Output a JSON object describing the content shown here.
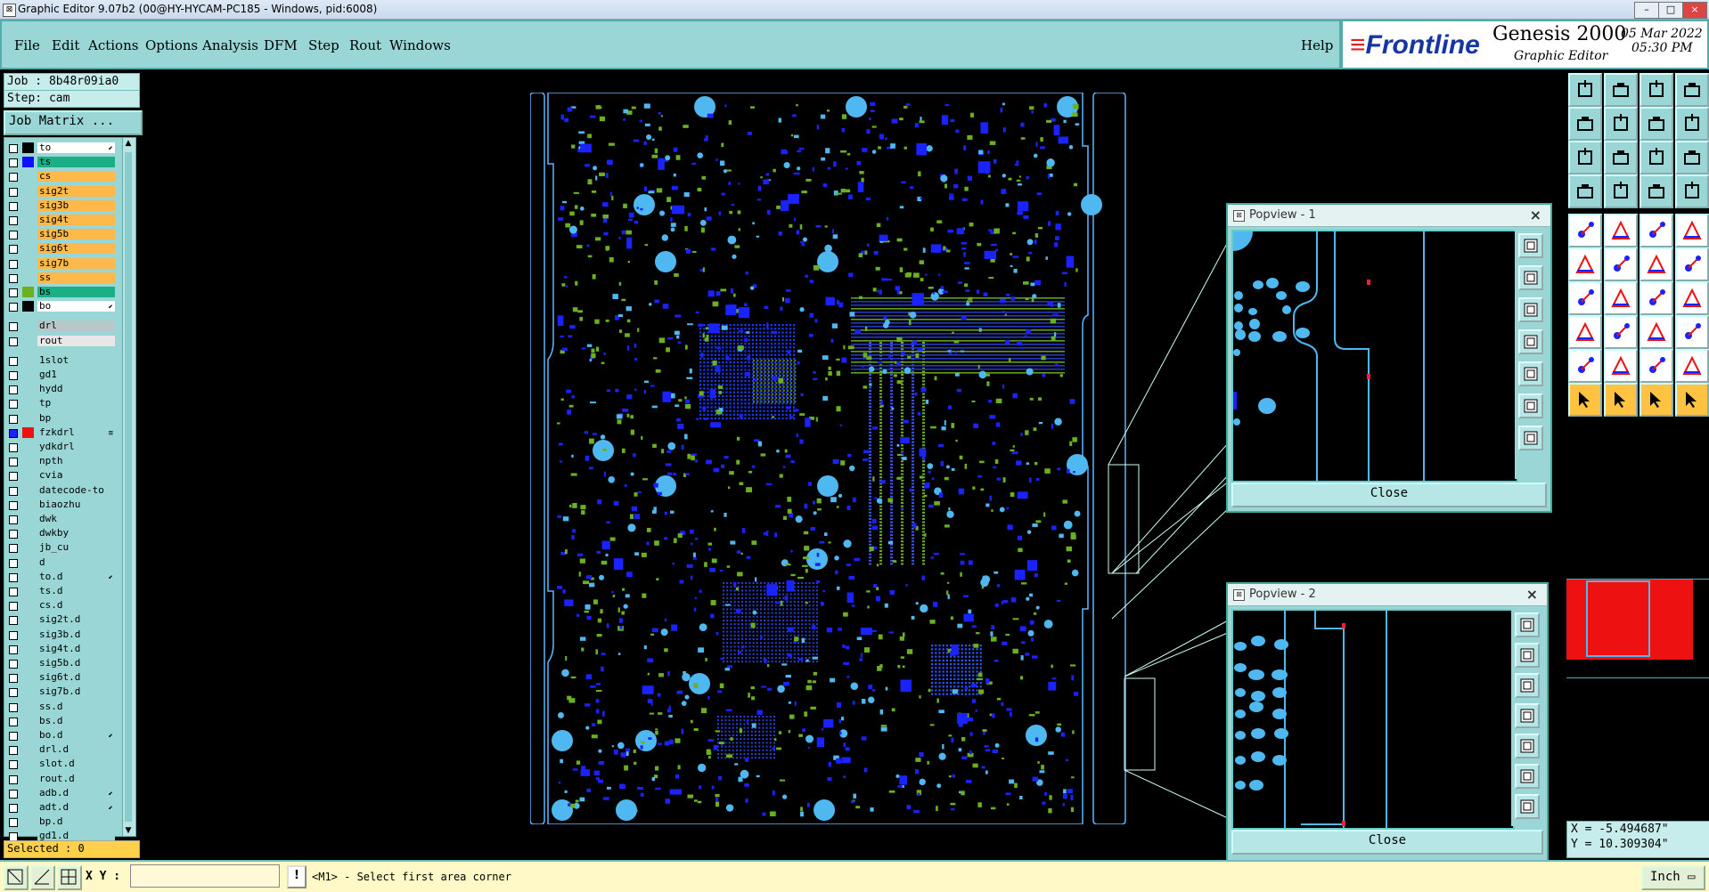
{
  "window": {
    "title": "Graphic Editor 9.07b2 (00@HY-HYCAM-PC185 - Windows, pid:6008)",
    "controls": [
      "–",
      "□",
      "×"
    ]
  },
  "menu": [
    "File",
    "Edit",
    "Actions",
    "Options",
    "Analysis",
    "DFM",
    "Step",
    "Rout",
    "Windows"
  ],
  "help_label": "Help",
  "brand": {
    "logo": "Frontline",
    "product": "Genesis 2000",
    "subtitle": "Graphic Editor",
    "date": "05 Mar 2022",
    "time": "05:30 PM"
  },
  "job": {
    "job_label": "Job : 8b48r09ia0",
    "step_label": "Step: cam",
    "matrix_button": "Job Matrix ..."
  },
  "layers": [
    {
      "name": "to",
      "color": "#ffffff",
      "swatch": "#000000",
      "mark": "⬋"
    },
    {
      "name": "ts",
      "color": "#1aaf84",
      "swatch": "#1010ff",
      "mark": ""
    },
    {
      "name": "cs",
      "color": "#ffb84a",
      "swatch": "",
      "mark": ""
    },
    {
      "name": "sig2t",
      "color": "#ffb84a",
      "swatch": "",
      "mark": ""
    },
    {
      "name": "sig3b",
      "color": "#ffb84a",
      "swatch": "",
      "mark": ""
    },
    {
      "name": "sig4t",
      "color": "#ffb84a",
      "swatch": "",
      "mark": ""
    },
    {
      "name": "sig5b",
      "color": "#ffb84a",
      "swatch": "",
      "mark": ""
    },
    {
      "name": "sig6t",
      "color": "#ffb84a",
      "swatch": "",
      "mark": ""
    },
    {
      "name": "sig7b",
      "color": "#ffb84a",
      "swatch": "",
      "mark": ""
    },
    {
      "name": "ss",
      "color": "#ffb84a",
      "swatch": "",
      "mark": ""
    },
    {
      "name": "bs",
      "color": "#1aaf84",
      "swatch": "#6ab020",
      "mark": ""
    },
    {
      "name": "bo",
      "color": "#ffffff",
      "swatch": "#000000",
      "mark": "⬋"
    },
    {
      "name": "drl",
      "color": "#b8c8c8",
      "swatch": "",
      "mark": ""
    },
    {
      "name": "rout",
      "color": "#e8e8e8",
      "swatch": "",
      "mark": ""
    },
    {
      "name": "1slot",
      "color": "#9ad6d6",
      "swatch": "",
      "mark": ""
    },
    {
      "name": "gd1",
      "color": "#9ad6d6",
      "swatch": "",
      "mark": ""
    },
    {
      "name": "hydd",
      "color": "#9ad6d6",
      "swatch": "",
      "mark": ""
    },
    {
      "name": "tp",
      "color": "#9ad6d6",
      "swatch": "",
      "mark": ""
    },
    {
      "name": "bp",
      "color": "#9ad6d6",
      "swatch": "",
      "mark": ""
    },
    {
      "name": "fzkdrl",
      "color": "#9ad6d6",
      "swatch": "#ee1111",
      "mark": "≡"
    },
    {
      "name": "ydkdrl",
      "color": "#9ad6d6",
      "swatch": "",
      "mark": ""
    },
    {
      "name": "npth",
      "color": "#9ad6d6",
      "swatch": "",
      "mark": ""
    },
    {
      "name": "cvia",
      "color": "#9ad6d6",
      "swatch": "",
      "mark": ""
    },
    {
      "name": "datecode-to",
      "color": "#9ad6d6",
      "swatch": "",
      "mark": ""
    },
    {
      "name": "biaozhu",
      "color": "#9ad6d6",
      "swatch": "",
      "mark": ""
    },
    {
      "name": "dwk",
      "color": "#9ad6d6",
      "swatch": "",
      "mark": ""
    },
    {
      "name": "dwkby",
      "color": "#9ad6d6",
      "swatch": "",
      "mark": ""
    },
    {
      "name": "jb_cu",
      "color": "#9ad6d6",
      "swatch": "",
      "mark": ""
    },
    {
      "name": "d",
      "color": "#9ad6d6",
      "swatch": "",
      "mark": ""
    },
    {
      "name": "to.d",
      "color": "#9ad6d6",
      "swatch": "",
      "mark": "⬋"
    },
    {
      "name": "ts.d",
      "color": "#9ad6d6",
      "swatch": "",
      "mark": ""
    },
    {
      "name": "cs.d",
      "color": "#9ad6d6",
      "swatch": "",
      "mark": ""
    },
    {
      "name": "sig2t.d",
      "color": "#9ad6d6",
      "swatch": "",
      "mark": ""
    },
    {
      "name": "sig3b.d",
      "color": "#9ad6d6",
      "swatch": "",
      "mark": ""
    },
    {
      "name": "sig4t.d",
      "color": "#9ad6d6",
      "swatch": "",
      "mark": ""
    },
    {
      "name": "sig5b.d",
      "color": "#9ad6d6",
      "swatch": "",
      "mark": ""
    },
    {
      "name": "sig6t.d",
      "color": "#9ad6d6",
      "swatch": "",
      "mark": ""
    },
    {
      "name": "sig7b.d",
      "color": "#9ad6d6",
      "swatch": "",
      "mark": ""
    },
    {
      "name": "ss.d",
      "color": "#9ad6d6",
      "swatch": "",
      "mark": ""
    },
    {
      "name": "bs.d",
      "color": "#9ad6d6",
      "swatch": "",
      "mark": ""
    },
    {
      "name": "bo.d",
      "color": "#9ad6d6",
      "swatch": "",
      "mark": "⬋"
    },
    {
      "name": "drl.d",
      "color": "#9ad6d6",
      "swatch": "",
      "mark": ""
    },
    {
      "name": "slot.d",
      "color": "#9ad6d6",
      "swatch": "",
      "mark": ""
    },
    {
      "name": "rout.d",
      "color": "#9ad6d6",
      "swatch": "",
      "mark": ""
    },
    {
      "name": "adb.d",
      "color": "#9ad6d6",
      "swatch": "",
      "mark": "⬋"
    },
    {
      "name": "adt.d",
      "color": "#9ad6d6",
      "swatch": "",
      "mark": "⬋"
    },
    {
      "name": "bp.d",
      "color": "#9ad6d6",
      "swatch": "",
      "mark": ""
    },
    {
      "name": "gd1.d",
      "color": "#9ad6d6",
      "swatch": "",
      "mark": ""
    }
  ],
  "selected_label": "Selected : 0",
  "popview1": {
    "title": "Popview - 1",
    "close": "Close"
  },
  "popview2": {
    "title": "Popview - 2",
    "close": "Close"
  },
  "coords": {
    "x": "X = -5.494687\"",
    "y": "Y = 10.309304\""
  },
  "bottom": {
    "xy_label": "X Y :",
    "xy_value": "",
    "prompt": "<M1> - Select first area corner",
    "prompt_button": "!",
    "units": "Inch"
  },
  "colors": {
    "panel": "#9ad6d6",
    "cyan_feature": "#4fb8f0",
    "blue_feature": "#1a23ff",
    "green_feature": "#6ab020",
    "board_outline": "#5fb6ff"
  }
}
